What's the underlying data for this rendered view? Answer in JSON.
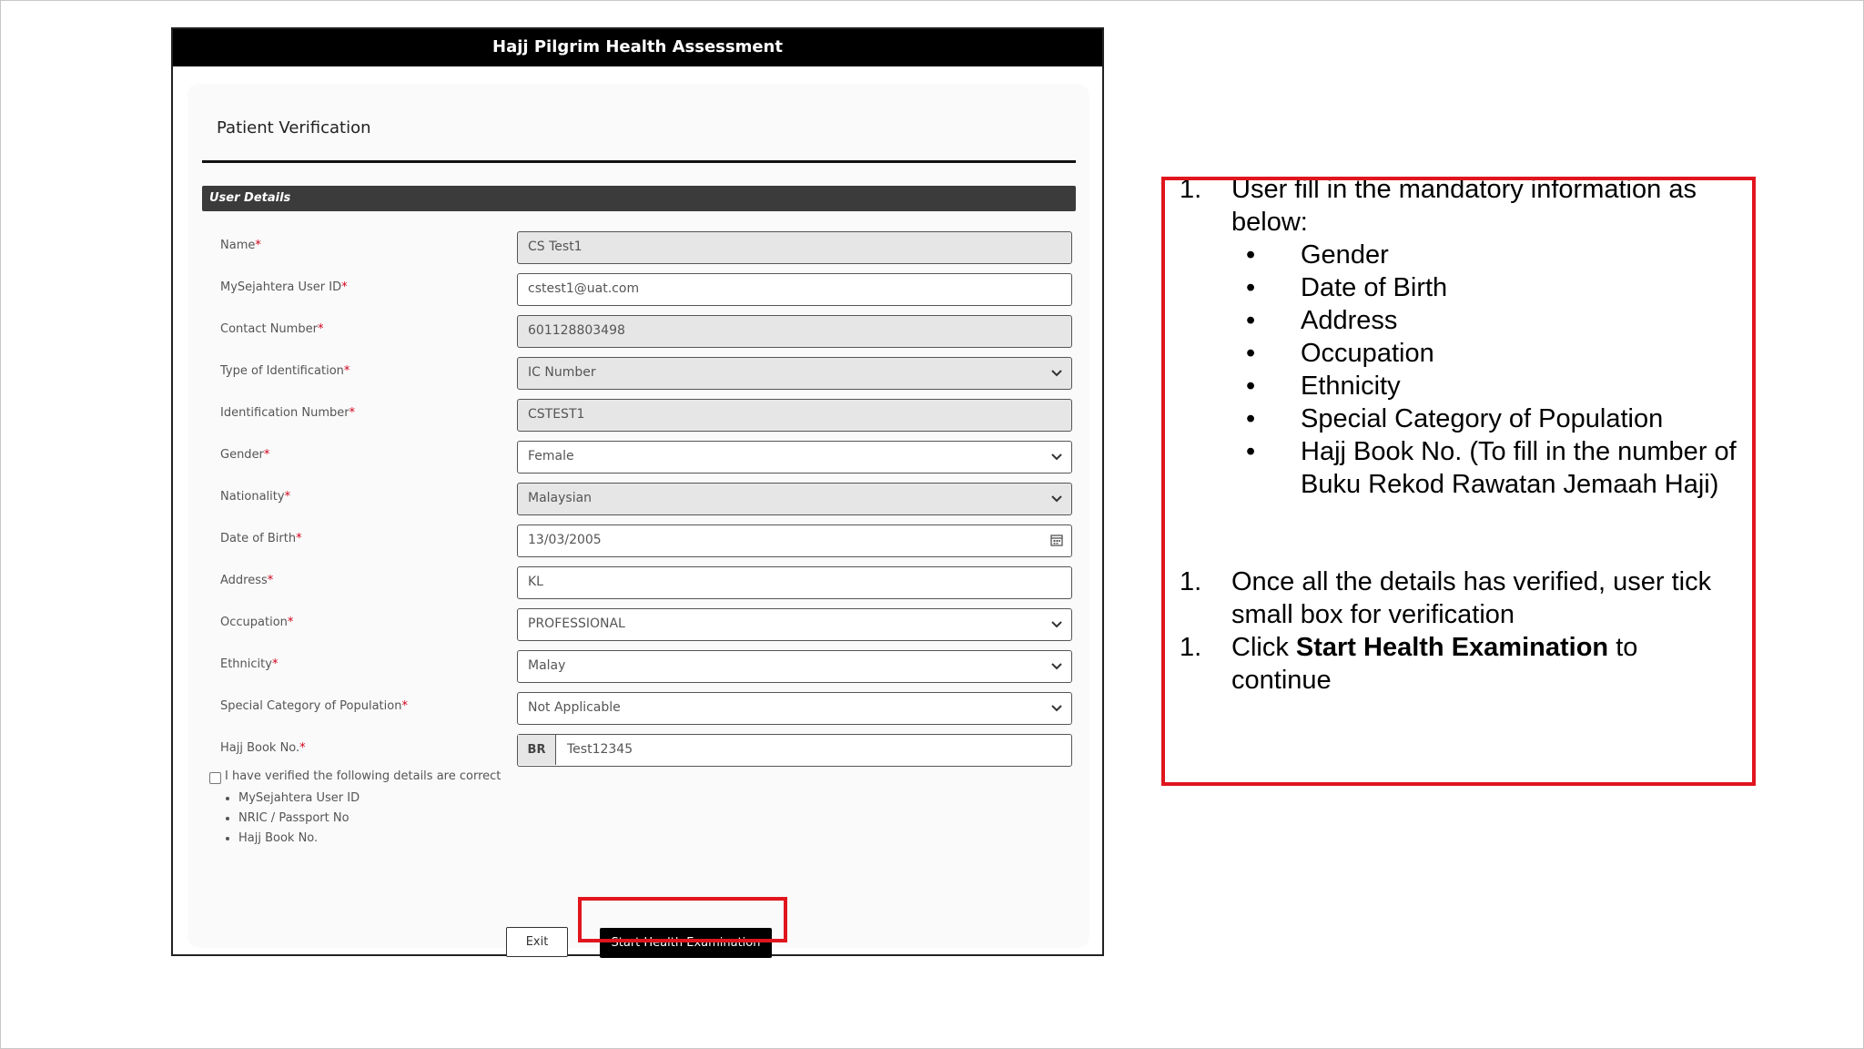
{
  "window": {
    "title": "Hajj Pilgrim Health Assessment"
  },
  "page": {
    "title": "Patient Verification"
  },
  "section": {
    "title": "User Details"
  },
  "form": {
    "name": {
      "label": "Name",
      "value": "CS Test1"
    },
    "user_id": {
      "label": "MySejahtera User ID",
      "value": "cstest1@uat.com"
    },
    "contact": {
      "label": "Contact Number",
      "value": "601128803498"
    },
    "id_type": {
      "label": "Type of Identification",
      "value": "IC Number"
    },
    "id_number": {
      "label": "Identification Number",
      "value": "CSTEST1"
    },
    "gender": {
      "label": "Gender",
      "value": "Female"
    },
    "nationality": {
      "label": "Nationality",
      "value": "Malaysian"
    },
    "dob": {
      "label": "Date of Birth",
      "value": "13/03/2005"
    },
    "address": {
      "label": "Address",
      "value": "KL"
    },
    "occupation": {
      "label": "Occupation",
      "value": "PROFESSIONAL"
    },
    "ethnicity": {
      "label": "Ethnicity",
      "value": "Malay"
    },
    "special_category": {
      "label": "Special Category of Population",
      "value": "Not Applicable"
    },
    "hajj_book": {
      "label": "Hajj Book No.",
      "prefix": "BR",
      "value": "Test12345"
    },
    "required_mark": "*"
  },
  "verification": {
    "label": "I have verified the following details are correct",
    "checked": false,
    "items": [
      "MySejahtera User ID",
      "NRIC / Passport No",
      "Hajj Book No."
    ]
  },
  "buttons": {
    "exit": "Exit",
    "start": "Start Health Examination"
  },
  "instructions": {
    "step1_number": "1.",
    "step1_text": "User fill in the mandatory information as below:",
    "step1_items": [
      "Gender",
      "Date of Birth",
      "Address",
      "Occupation",
      "Ethnicity",
      "Special Category of Population",
      "Hajj Book No. (To fill in the number of Buku Rekod Rawatan Jemaah Haji)"
    ],
    "step2_number": "1.",
    "step2_text": "Once all the details has verified, user tick small box for verification",
    "step3_number": "1.",
    "step3_prefix": "Click ",
    "step3_bold": "Start Health Examination",
    "step3_suffix": " to continue"
  },
  "colors": {
    "highlight": "#e0151d",
    "titlebar": "#000000",
    "section_bar": "#3b3b3b"
  }
}
